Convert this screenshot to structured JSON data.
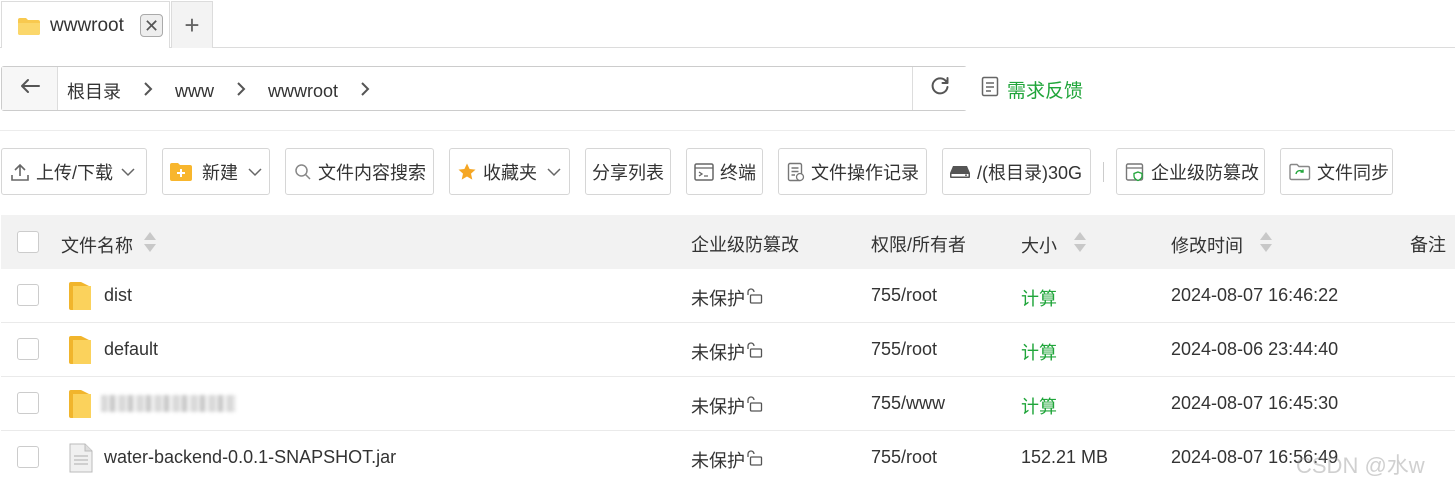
{
  "tab": {
    "label": "wwwroot",
    "close": "✕",
    "add": "+"
  },
  "path": {
    "crumbs": [
      "根目录",
      "www",
      "wwwroot"
    ]
  },
  "feedback": "需求反馈",
  "toolbar": {
    "upload": "上传/下载",
    "new": "新建",
    "search": "文件内容搜索",
    "favorites": "收藏夹",
    "share": "分享列表",
    "terminal": "终端",
    "log": "文件操作记录",
    "disk": "/(根目录)30G",
    "tamper": "企业级防篡改",
    "sync": "文件同步"
  },
  "table": {
    "headers": {
      "name": "文件名称",
      "tamper": "企业级防篡改",
      "perm": "权限/所有者",
      "size": "大小",
      "mtime": "修改时间",
      "note": "备注"
    },
    "rows": [
      {
        "type": "folder",
        "name": "dist",
        "tamper": "未保护",
        "perm": "755/root",
        "size": "计算",
        "mtime": "2024-08-07 16:46:22"
      },
      {
        "type": "folder",
        "name": "default",
        "tamper": "未保护",
        "perm": "755/root",
        "size": "计算",
        "mtime": "2024-08-06 23:44:40"
      },
      {
        "type": "folder",
        "name": "",
        "tamper": "未保护",
        "perm": "755/www",
        "size": "计算",
        "mtime": "2024-08-07 16:45:30"
      },
      {
        "type": "file",
        "name": "water-backend-0.0.1-SNAPSHOT.jar",
        "tamper": "未保护",
        "perm": "755/root",
        "size": "152.21 MB",
        "mtime": "2024-08-07 16:56:49"
      }
    ]
  },
  "watermark": "CSDN @水w",
  "colors": {
    "accent": "#20a53a",
    "folder": "#f8c94f",
    "header_bg": "#f2f2f2"
  },
  "icons": [
    "folder-icon",
    "close-icon",
    "plus-icon",
    "arrow-left-icon",
    "chevron-right-icon",
    "refresh-icon",
    "document-edit-icon",
    "upload-icon",
    "chevron-down-icon",
    "new-folder-icon",
    "search-icon",
    "star-icon",
    "terminal-icon",
    "log-icon",
    "disk-icon",
    "shield-icon",
    "sync-icon",
    "sort-icon",
    "lock-open-icon",
    "file-icon"
  ]
}
